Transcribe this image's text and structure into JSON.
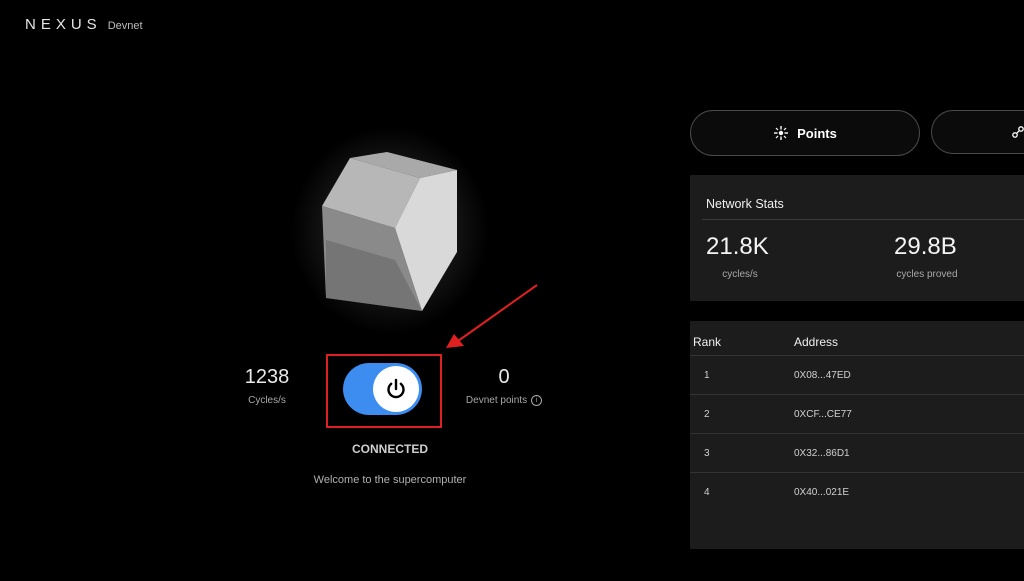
{
  "brand": {
    "logo": "NEXUS",
    "network": "Devnet"
  },
  "node": {
    "cycles_value": "1238",
    "cycles_label": "Cycles/s",
    "points_value": "0",
    "points_label": "Devnet points",
    "status": "CONNECTED",
    "welcome": "Welcome to the supercomputer",
    "toggle_on": true,
    "accent_color": "#3d8cf0"
  },
  "tabs": [
    {
      "label": "Points",
      "icon": "sparkle-icon"
    },
    {
      "label": "",
      "icon": "network-icon"
    }
  ],
  "network_stats": {
    "title": "Network Stats",
    "cycles_rate_value": "21.8K",
    "cycles_rate_label": "cycles/s",
    "cycles_proved_value": "29.8B",
    "cycles_proved_label": "cycles proved"
  },
  "leaderboard": {
    "headers": {
      "rank": "Rank",
      "address": "Address"
    },
    "rows": [
      {
        "rank": "1",
        "address": "0X08...47ED"
      },
      {
        "rank": "2",
        "address": "0XCF...CE77"
      },
      {
        "rank": "3",
        "address": "0X32...86D1"
      },
      {
        "rank": "4",
        "address": "0X40...021E"
      }
    ]
  }
}
